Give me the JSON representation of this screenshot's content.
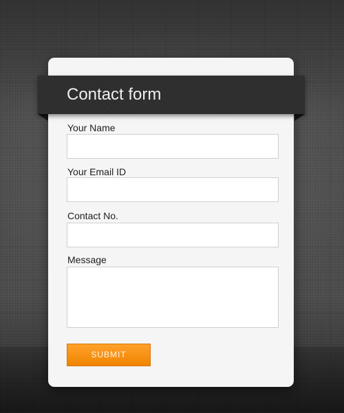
{
  "form": {
    "title": "Contact form",
    "fields": [
      {
        "label": "Your Name",
        "value": ""
      },
      {
        "label": "Your Email ID",
        "value": ""
      },
      {
        "label": "Contact No.",
        "value": ""
      },
      {
        "label": "Message",
        "value": ""
      }
    ],
    "submit_label": "SUBMIT"
  },
  "colors": {
    "ribbon": "#2c2c2c",
    "card": "#f5f5f5",
    "submit": "#f08400"
  }
}
